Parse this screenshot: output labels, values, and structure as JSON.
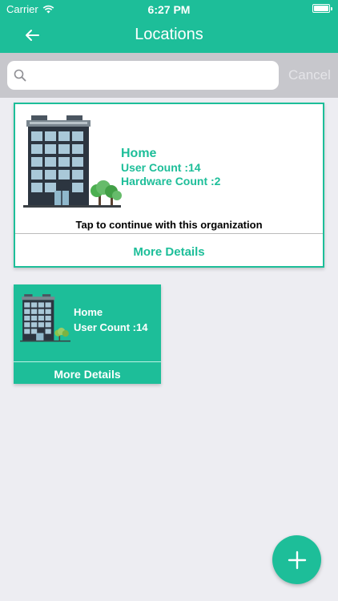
{
  "status_bar": {
    "carrier": "Carrier",
    "time": "6:27 PM"
  },
  "nav": {
    "title": "Locations",
    "back_icon": "arrow-left-icon"
  },
  "search": {
    "placeholder": "",
    "value": "",
    "cancel_label": "Cancel"
  },
  "locations": [
    {
      "name": "Home",
      "user_count": "User Count :14",
      "hardware_count": "Hardware Count :2",
      "tap_text": "Tap to continue with this organization",
      "more_label": "More Details"
    },
    {
      "name": "Home",
      "user_count": "User Count :14",
      "more_label": "More Details"
    }
  ],
  "fab": {
    "icon": "plus-icon"
  },
  "colors": {
    "accent": "#1dbe99",
    "background": "#ededf2"
  }
}
